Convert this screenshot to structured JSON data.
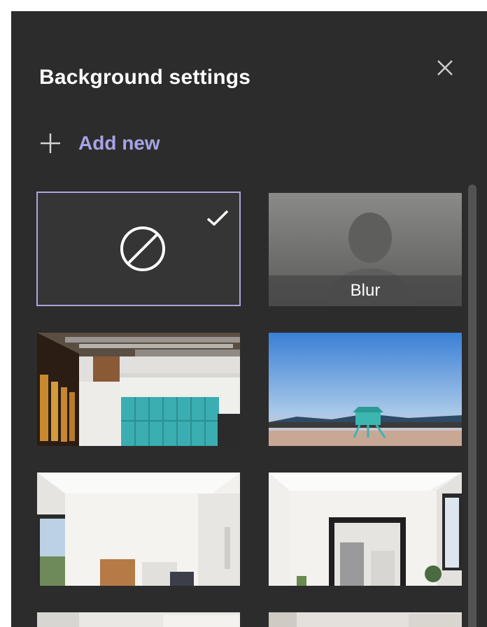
{
  "panel": {
    "title": "Background settings",
    "add_new_label": "Add new"
  },
  "icons": {
    "close": "close-icon",
    "add": "plus-icon",
    "none": "ban-icon",
    "selected": "checkmark-icon"
  },
  "backgrounds": [
    {
      "id": "none",
      "selected": true
    },
    {
      "id": "blur",
      "label": "Blur",
      "selected": false
    },
    {
      "id": "office-lockers",
      "selected": false
    },
    {
      "id": "beach-lifeguard",
      "selected": false
    },
    {
      "id": "white-room-window",
      "selected": false
    },
    {
      "id": "white-room-mirror",
      "selected": false
    }
  ],
  "colors": {
    "panel_bg": "#2d2c2c",
    "accent": "#a8a3e6",
    "selected_border": "#aaa6de"
  }
}
